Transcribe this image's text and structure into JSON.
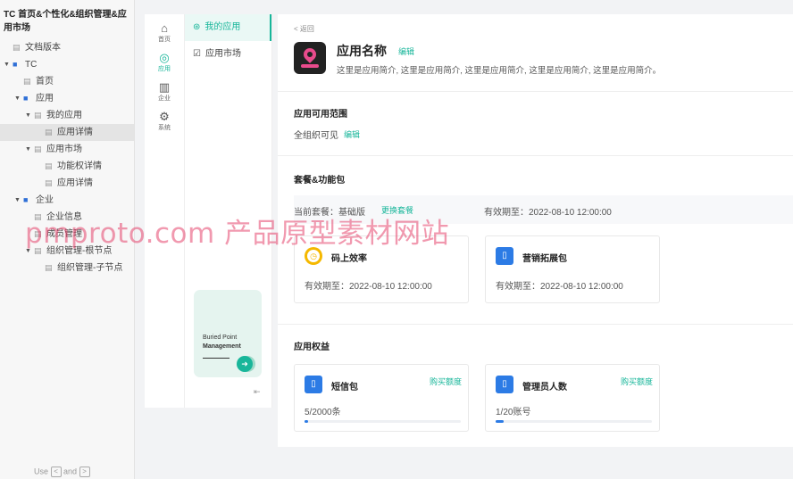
{
  "doc": {
    "title": "TC 首页&个性化&组织管理&应用市场",
    "tree": [
      {
        "label": "文档版本",
        "level": 0,
        "type": "page",
        "expand": "none",
        "selected": false
      },
      {
        "label": "TC",
        "level": 0,
        "type": "folder",
        "expand": "open",
        "selected": false
      },
      {
        "label": "首页",
        "level": 1,
        "type": "page",
        "expand": "none",
        "selected": false
      },
      {
        "label": "应用",
        "level": 1,
        "type": "folder",
        "expand": "open",
        "selected": false
      },
      {
        "label": "我的应用",
        "level": 2,
        "type": "page",
        "expand": "open",
        "selected": false
      },
      {
        "label": "应用详情",
        "level": 3,
        "type": "page",
        "expand": "none",
        "selected": true
      },
      {
        "label": "应用市场",
        "level": 2,
        "type": "page",
        "expand": "open",
        "selected": false
      },
      {
        "label": "功能权详情",
        "level": 3,
        "type": "page",
        "expand": "none",
        "selected": false
      },
      {
        "label": "应用详情",
        "level": 3,
        "type": "page",
        "expand": "none",
        "selected": false
      },
      {
        "label": "企业",
        "level": 1,
        "type": "folder",
        "expand": "open",
        "selected": false
      },
      {
        "label": "企业信息",
        "level": 2,
        "type": "page",
        "expand": "none",
        "selected": false
      },
      {
        "label": "成员管理",
        "level": 2,
        "type": "page",
        "expand": "none",
        "selected": false
      },
      {
        "label": "组织管理-根节点",
        "level": 2,
        "type": "page",
        "expand": "open",
        "selected": false
      },
      {
        "label": "组织管理-子节点",
        "level": 3,
        "type": "page",
        "expand": "none",
        "selected": false
      }
    ],
    "footer": {
      "use": "Use",
      "and": "and",
      "key_prev": "<",
      "key_next": ">"
    }
  },
  "rail": [
    {
      "label": "首页",
      "icon": "home-icon",
      "glyph": "⌂",
      "active": false
    },
    {
      "label": "应用",
      "icon": "apps-icon",
      "glyph": "◎",
      "active": true
    },
    {
      "label": "企业",
      "icon": "building-icon",
      "glyph": "▥",
      "active": false
    },
    {
      "label": "系统",
      "icon": "system-icon",
      "glyph": "⚙",
      "active": false
    }
  ],
  "submenu": [
    {
      "label": "我的应用",
      "icon": "my-apps-icon",
      "glyph": "⊛",
      "active": true
    },
    {
      "label": "应用市场",
      "icon": "market-icon",
      "glyph": "☑",
      "active": false
    }
  ],
  "promo": {
    "line1": "Buried Point",
    "line2": "Management",
    "arrow": "➜"
  },
  "collapse_glyph": "⇤",
  "detail": {
    "back": "< 返回",
    "app_name": "应用名称",
    "edit": "编辑",
    "intro": "这里是应用简介, 这里是应用简介, 这里是应用简介, 这里是应用简介, 这里是应用简介。",
    "scope_title": "应用可用范围",
    "scope_value": "全组织可见",
    "scope_edit": "编辑",
    "package_title": "套餐&功能包",
    "current_package": "当前套餐：基础版",
    "change_package": "更换套餐",
    "package_validity": "有效期至：2022-08-10 12:00:00",
    "feature_packs": [
      {
        "name": "码上效率",
        "icon": "clock-icon",
        "validity": "有效期至：2022-08-10 12:00:00"
      },
      {
        "name": "营销拓展包",
        "icon": "phone-icon",
        "validity": "有效期至：2022-08-10 12:00:00"
      }
    ],
    "rights_title": "应用权益",
    "rights": [
      {
        "name": "短信包",
        "icon": "phone-icon",
        "buy": "购买额度",
        "usage": "5/2000条",
        "progress": 0.0025
      },
      {
        "name": "管理员人数",
        "icon": "phone-icon",
        "buy": "购买额度",
        "usage": "1/20账号",
        "progress": 0.05
      }
    ]
  },
  "watermark": "pmproto.com 产品原型素材网站",
  "colors": {
    "accent": "#18b69a",
    "blue": "#2c7be5",
    "folder": "#2e6fd6"
  }
}
